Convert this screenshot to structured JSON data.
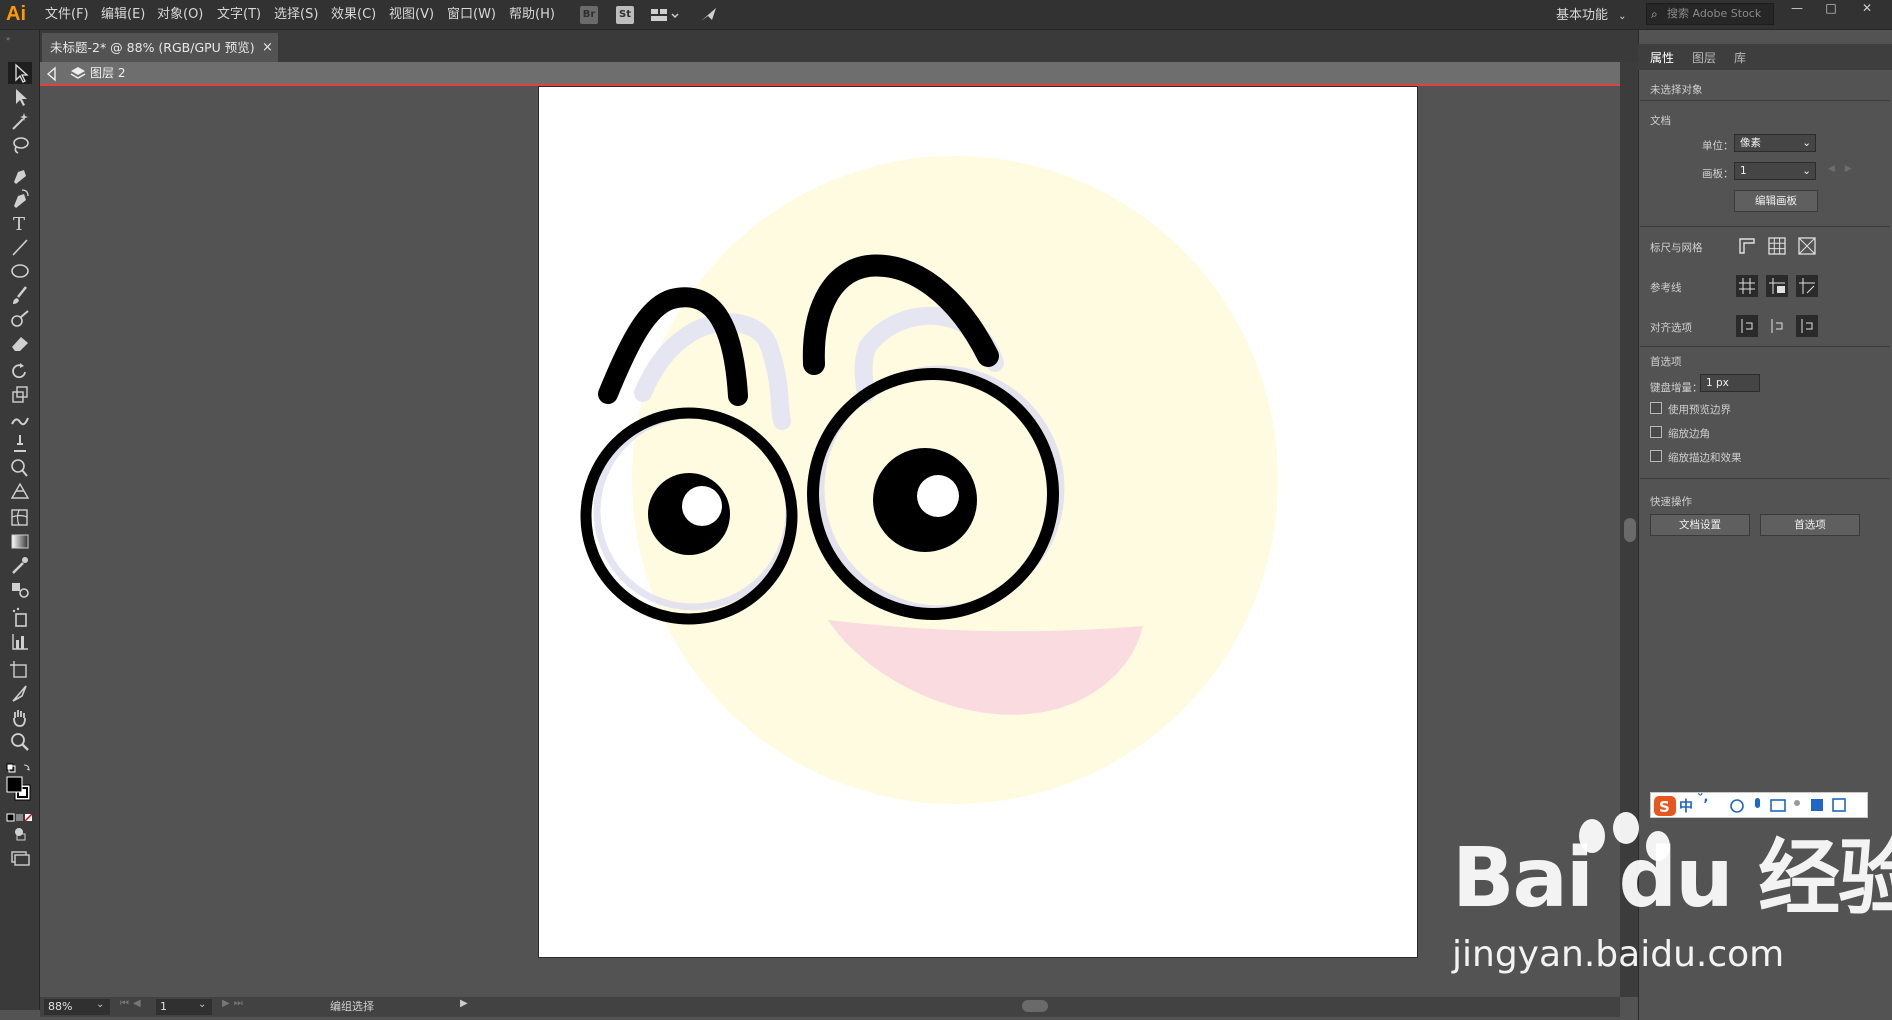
{
  "app": {
    "logo": "Ai",
    "workspace": "基本功能",
    "search_placeholder": "搜索 Adobe Stock"
  },
  "menu": [
    "文件(F)",
    "编辑(E)",
    "对象(O)",
    "文字(T)",
    "选择(S)",
    "效果(C)",
    "视图(V)",
    "窗口(W)",
    "帮助(H)"
  ],
  "menubar_icons": {
    "bridge": "Br",
    "stock": "St"
  },
  "window_buttons": [
    "—",
    "□",
    "✕"
  ],
  "document": {
    "tab_title": "未标题-2* @ 88% (RGB/GPU 预览)",
    "tab_close": "×",
    "layer": "图层 2"
  },
  "status": {
    "zoom": "88%",
    "page": "1",
    "text": "编组选择"
  },
  "panel": {
    "tabs": [
      "属性",
      "图层",
      "库"
    ],
    "no_selection": "未选择对象",
    "document_heading": "文档",
    "unit_label": "单位：",
    "unit_value": "像素",
    "artboard_label": "画板：",
    "artboard_value": "1",
    "edit_artboard": "编辑画板",
    "rulers_grid": "标尺与网格",
    "guides": "参考线",
    "snap_options": "对齐选项",
    "preferences_heading": "首选项",
    "keyboard_increment_label": "键盘增量：",
    "keyboard_increment_value": "1 px",
    "checkboxes": [
      "使用预览边界",
      "缩放边角",
      "缩放描边和效果"
    ],
    "quick_actions": "快速操作",
    "doc_setup": "文档设置",
    "prefs_button": "首选项"
  },
  "ime": {
    "label": "中"
  },
  "watermark": {
    "main": "Bai du 经验",
    "sub": "jingyan.baidu.com"
  },
  "colors": {
    "face": "#fffbe0",
    "mouth": "#fadbe0",
    "stroke": "#000000",
    "accent_red": "#e24141",
    "ai_orange": "#ff9a00"
  }
}
